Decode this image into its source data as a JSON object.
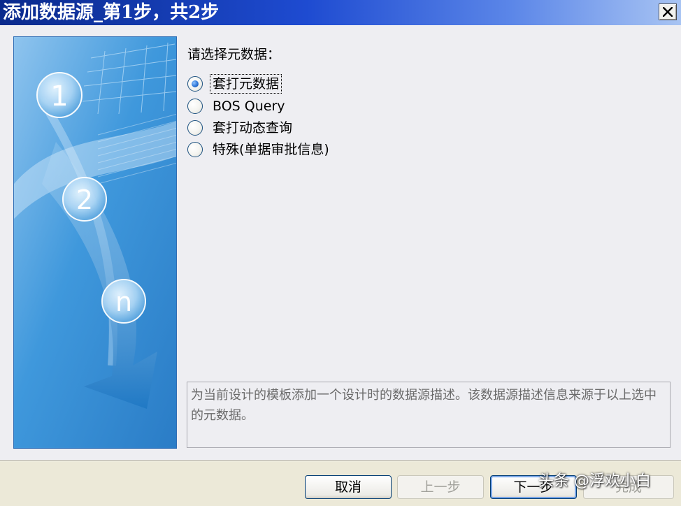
{
  "window": {
    "title": "添加数据源_第1步，共2步",
    "close_label": "×"
  },
  "sidebar_illustration": {
    "steps": [
      "1",
      "2",
      "n"
    ]
  },
  "form": {
    "prompt": "请选择元数据：",
    "options": [
      {
        "label": "套打元数据",
        "selected": true
      },
      {
        "label": "BOS Query",
        "selected": false
      },
      {
        "label": "套打动态查询",
        "selected": false
      },
      {
        "label": "特殊(单据审批信息)",
        "selected": false
      }
    ],
    "description": "为当前设计的模板添加一个设计时的数据源描述。该数据源描述信息来源于以上选中的元数据。"
  },
  "buttons": {
    "cancel": "取消",
    "previous": "上一步",
    "next": "下一步",
    "finish": "完成"
  },
  "watermark": "头条 @浮欢小白",
  "colors": {
    "title_bar": "#1e4bd1",
    "dialog_bg": "#eeeef2",
    "side_panel": "#3a93d6",
    "radio_dot": "#2f76d6"
  }
}
